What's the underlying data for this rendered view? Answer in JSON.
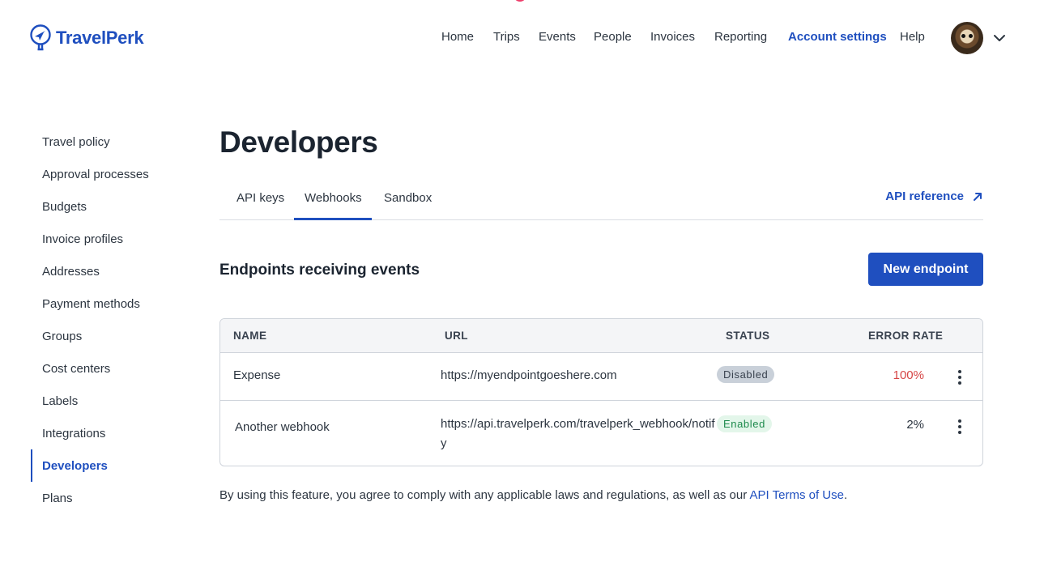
{
  "brand": {
    "name": "TravelPerk",
    "color": "#1f4fbf"
  },
  "nav": {
    "items": [
      {
        "label": "Home"
      },
      {
        "label": "Trips"
      },
      {
        "label": "Events"
      },
      {
        "label": "People"
      },
      {
        "label": "Invoices"
      },
      {
        "label": "Reporting"
      },
      {
        "label": "Account settings",
        "active": true
      },
      {
        "label": "Help"
      }
    ]
  },
  "sidebar": {
    "items": [
      {
        "label": "Travel policy"
      },
      {
        "label": "Approval processes"
      },
      {
        "label": "Budgets"
      },
      {
        "label": "Invoice profiles"
      },
      {
        "label": "Addresses"
      },
      {
        "label": "Payment methods"
      },
      {
        "label": "Groups"
      },
      {
        "label": "Cost centers"
      },
      {
        "label": "Labels"
      },
      {
        "label": "Integrations"
      },
      {
        "label": "Developers",
        "active": true
      },
      {
        "label": "Plans"
      }
    ]
  },
  "page": {
    "title": "Developers"
  },
  "tabs": {
    "items": [
      {
        "label": "API keys"
      },
      {
        "label": "Webhooks",
        "active": true
      },
      {
        "label": "Sandbox"
      }
    ],
    "api_reference": "API reference"
  },
  "section": {
    "title": "Endpoints receiving events",
    "new_button": "New endpoint"
  },
  "table": {
    "headers": {
      "name": "NAME",
      "url": "URL",
      "status": "STATUS",
      "error_rate": "ERROR RATE"
    },
    "rows": [
      {
        "name": "Expense",
        "url": "https://myendpointgoeshere.com",
        "status": "Disabled",
        "error_rate": "100%"
      },
      {
        "name": "Another webhook",
        "url": "https://api.travelperk.com/travelperk_webhook/notify",
        "status": "Enabled",
        "error_rate": "2%"
      }
    ]
  },
  "footer": {
    "text": "By using this feature, you agree to comply with any applicable laws and regulations, as well as our ",
    "link": "API Terms of Use",
    "end": "."
  },
  "colors": {
    "accent": "#1f4fbf",
    "error": "#d64545",
    "enabled": "#1d8a4c"
  }
}
